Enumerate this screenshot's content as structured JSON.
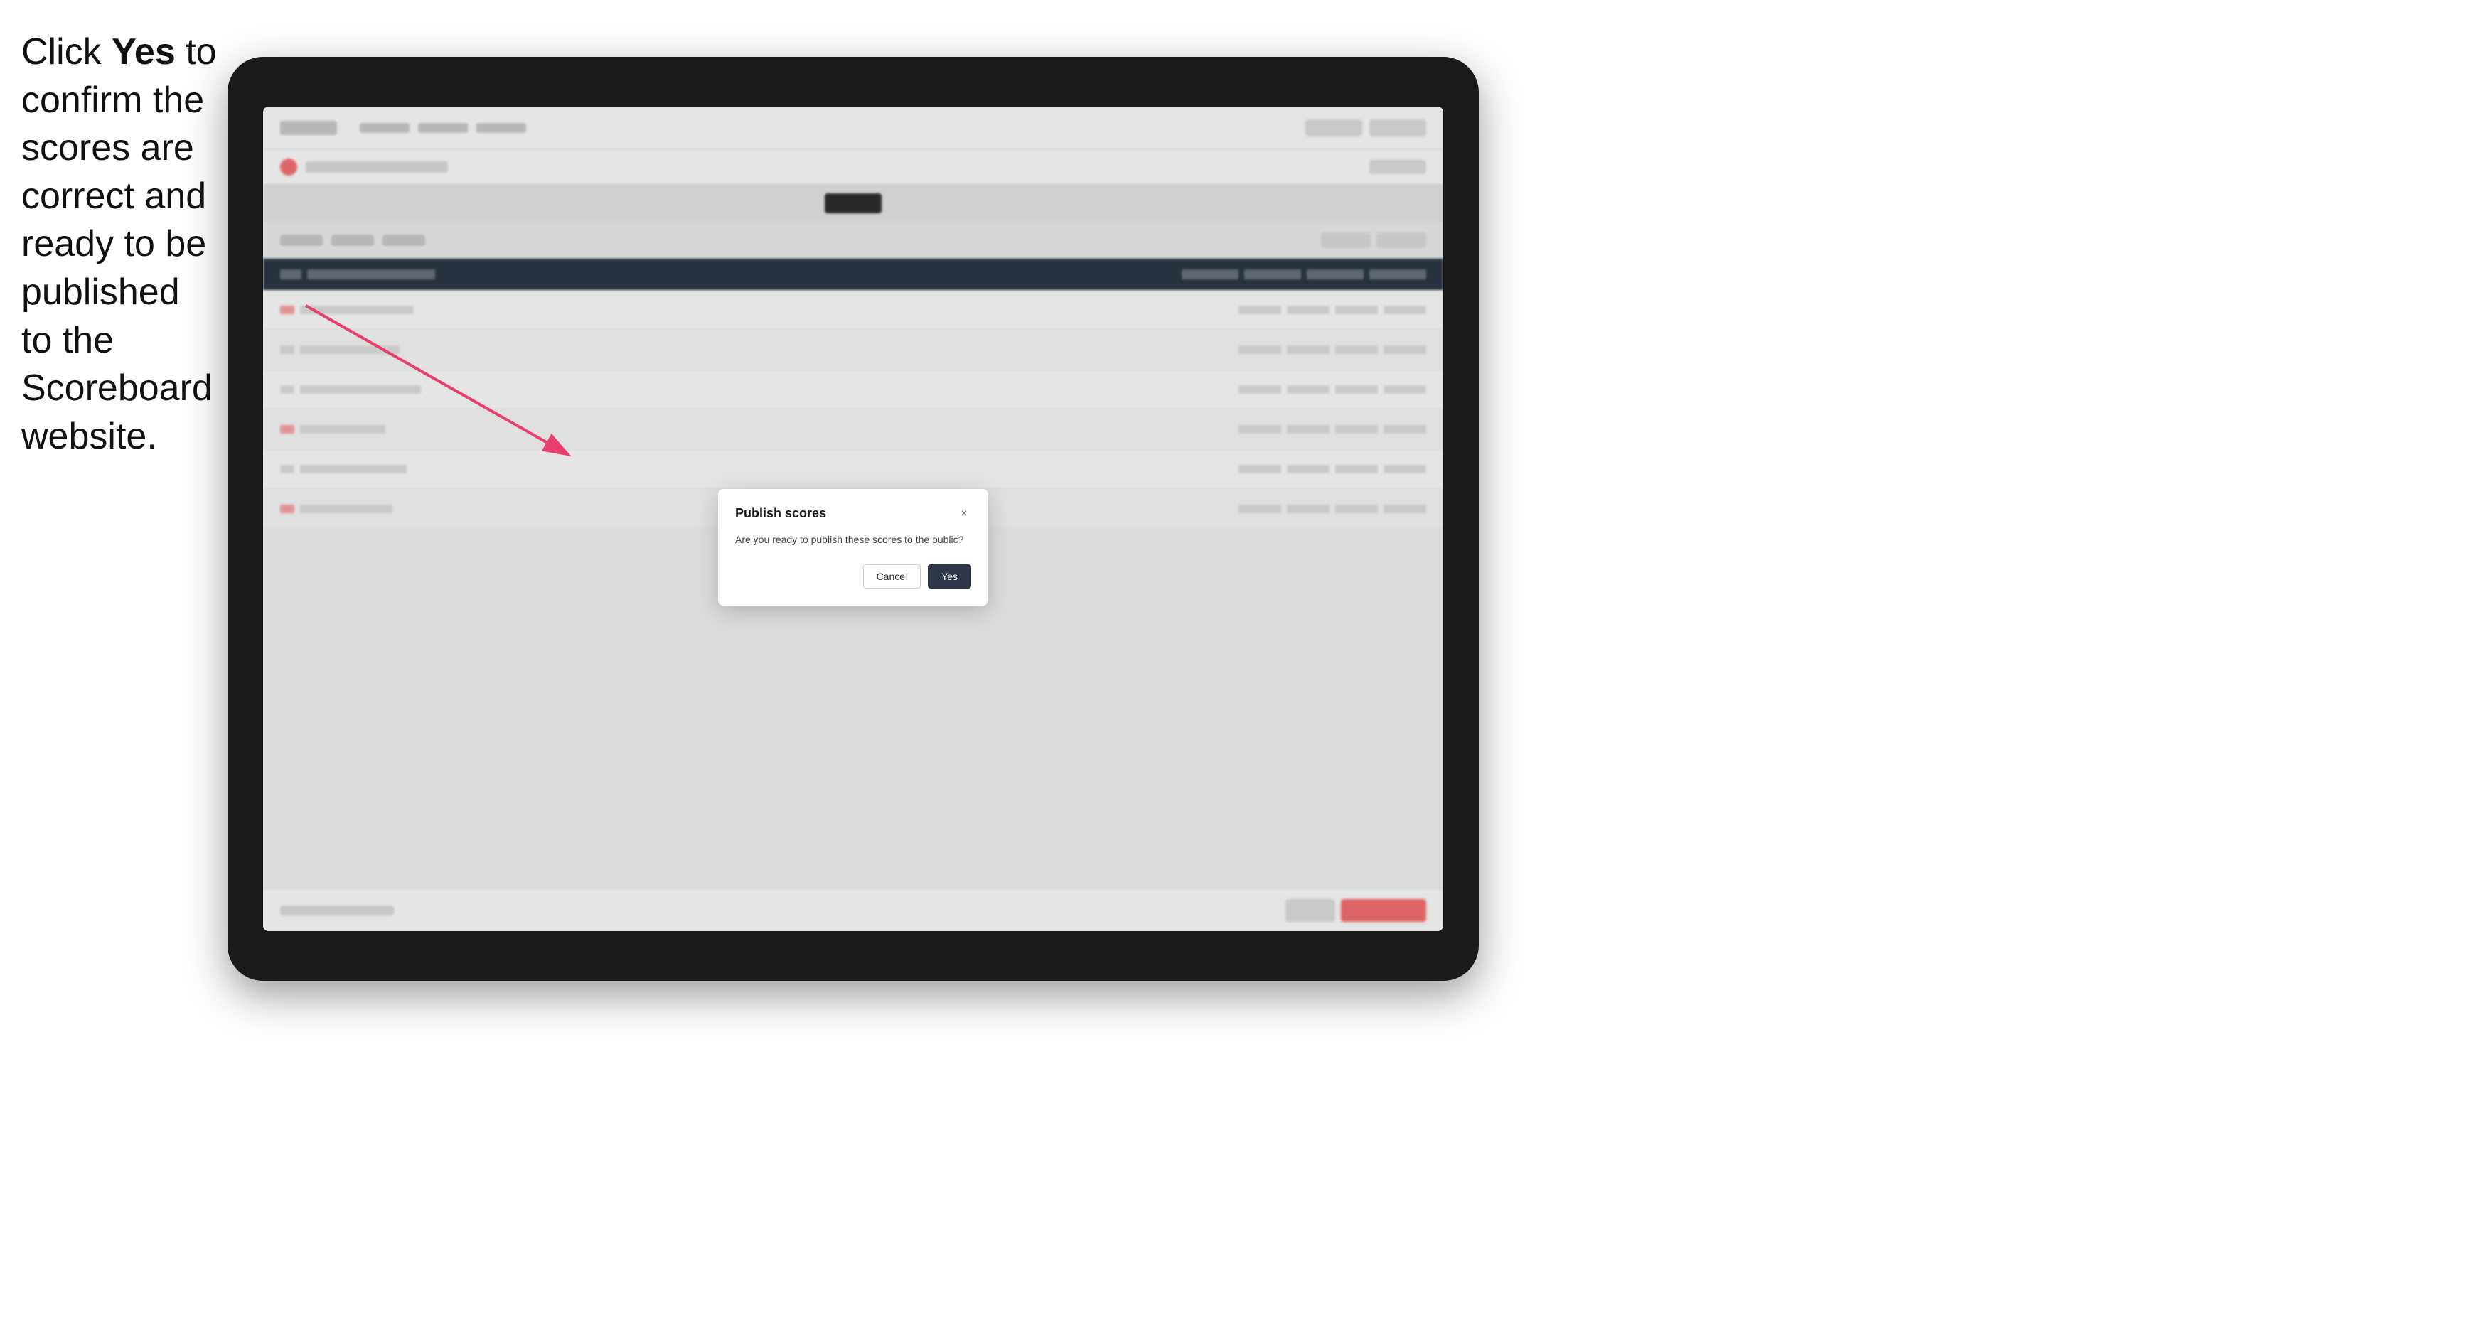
{
  "instruction": {
    "text_part1": "Click ",
    "text_bold": "Yes",
    "text_part2": " to confirm the scores are correct and ready to be published to the Scoreboard website."
  },
  "dialog": {
    "title": "Publish scores",
    "body": "Are you ready to publish these scores to the public?",
    "cancel_label": "Cancel",
    "yes_label": "Yes",
    "close_icon": "×"
  },
  "colors": {
    "yes_button_bg": "#2d3748",
    "cancel_button_bg": "#ffffff",
    "arrow_color": "#e83e6c"
  }
}
